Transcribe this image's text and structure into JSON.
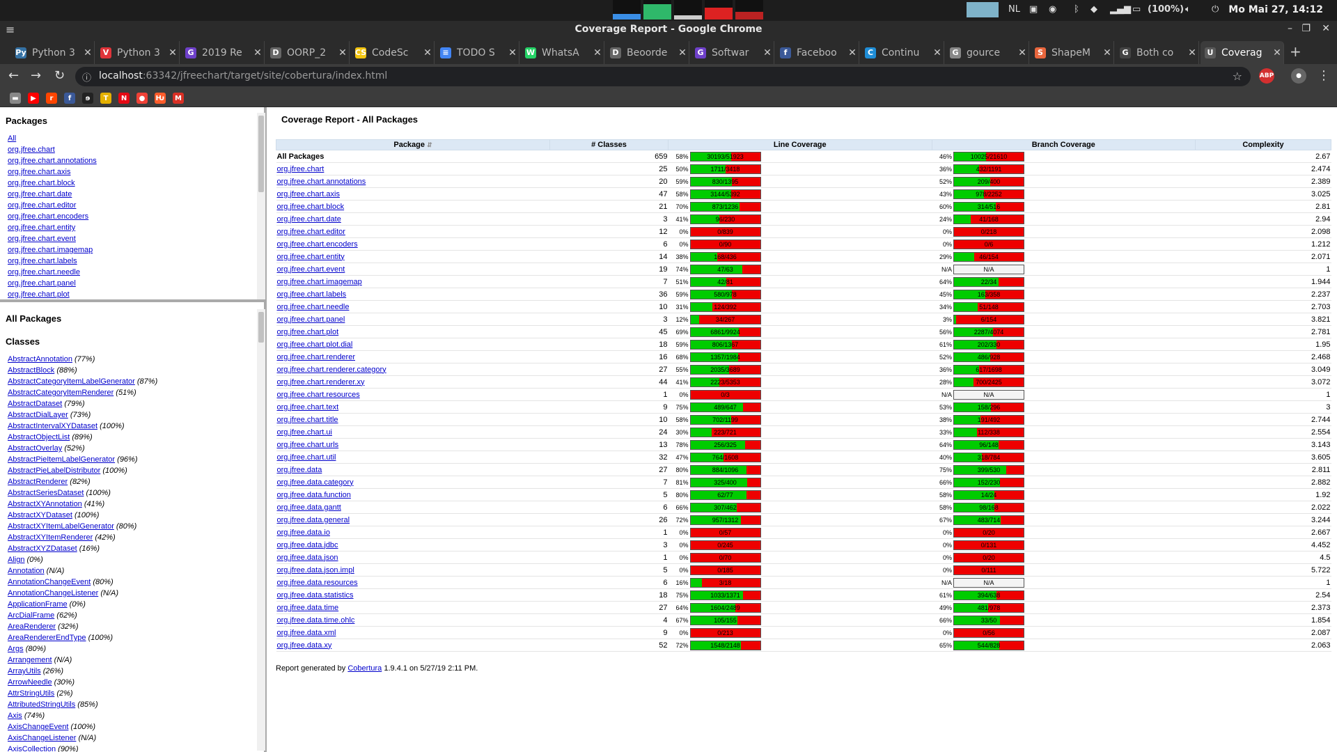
{
  "system": {
    "clock": "Mo Mai 27, 14:12",
    "battery": "(100%)",
    "keyboard": "NL"
  },
  "window": {
    "title": "Coverage Report - Google Chrome"
  },
  "tabs": [
    {
      "label": "Python 3",
      "icon": "python-icon",
      "color": "#3572a5",
      "glyph": "Py"
    },
    {
      "label": "Python 3",
      "icon": "vivaldi-icon",
      "color": "#e0343a",
      "glyph": "V"
    },
    {
      "label": "2019 Re",
      "icon": "github-icon",
      "color": "#6e40c9",
      "glyph": "G"
    },
    {
      "label": "OORP_2",
      "icon": "document-icon",
      "color": "#666",
      "glyph": "D"
    },
    {
      "label": "CodeSc",
      "icon": "codescene-icon",
      "color": "#f2c40f",
      "glyph": "CS"
    },
    {
      "label": "TODO S",
      "icon": "docs-icon",
      "color": "#4285f4",
      "glyph": "≡"
    },
    {
      "label": "WhatsA",
      "icon": "whatsapp-icon",
      "color": "#25d366",
      "glyph": "W"
    },
    {
      "label": "Beoorde",
      "icon": "document-icon",
      "color": "#666",
      "glyph": "D"
    },
    {
      "label": "Softwar",
      "icon": "github-icon",
      "color": "#6e40c9",
      "glyph": "G"
    },
    {
      "label": "Faceboo",
      "icon": "facebook-icon",
      "color": "#3b5998",
      "glyph": "f"
    },
    {
      "label": "Continu",
      "icon": "ci-icon",
      "color": "#1f8dd6",
      "glyph": "C"
    },
    {
      "label": "gource",
      "icon": "google-icon",
      "color": "#888",
      "glyph": "G"
    },
    {
      "label": "ShapeM",
      "icon": "shape-icon",
      "color": "#e8663d",
      "glyph": "S"
    },
    {
      "label": "Both co",
      "icon": "github-icon",
      "color": "#444",
      "glyph": "G"
    },
    {
      "label": "Coverag",
      "icon": "report-icon",
      "color": "#5a5a5a",
      "glyph": "U"
    }
  ],
  "address": {
    "host": "localhost",
    "rest": ":63342/jfreechart/target/site/cobertura/index.html"
  },
  "bookmarks": [
    {
      "icon": "folder-icon",
      "color": "#888",
      "glyph": "▬"
    },
    {
      "icon": "youtube-icon",
      "color": "#ff0000",
      "glyph": "▶"
    },
    {
      "icon": "reddit-icon",
      "color": "#ff4500",
      "glyph": "r"
    },
    {
      "icon": "facebook-icon",
      "color": "#3b5998",
      "glyph": "f"
    },
    {
      "icon": "pocket-icon",
      "color": "#222",
      "glyph": "ɘ"
    },
    {
      "icon": "tweakers-icon",
      "color": "#e5b100",
      "glyph": "T"
    },
    {
      "icon": "netflix-icon",
      "color": "#e50914",
      "glyph": "N"
    },
    {
      "icon": "reader-icon",
      "color": "#ef4136",
      "glyph": "●"
    },
    {
      "icon": "hacker-icon",
      "color": "#ff5c2b",
      "glyph": "Ƕ"
    },
    {
      "icon": "gmail-icon",
      "color": "#d93025",
      "glyph": "M"
    }
  ],
  "packages_frame": {
    "heading": "Packages",
    "items": [
      "All",
      "org.jfree.chart",
      "org.jfree.chart.annotations",
      "org.jfree.chart.axis",
      "org.jfree.chart.block",
      "org.jfree.chart.date",
      "org.jfree.chart.editor",
      "org.jfree.chart.encoders",
      "org.jfree.chart.entity",
      "org.jfree.chart.event",
      "org.jfree.chart.imagemap",
      "org.jfree.chart.labels",
      "org.jfree.chart.needle",
      "org.jfree.chart.panel",
      "org.jfree.chart.plot"
    ]
  },
  "classes_frame": {
    "title": "All Packages",
    "heading": "Classes",
    "items": [
      {
        "name": "AbstractAnnotation",
        "pct": "(77%)"
      },
      {
        "name": "AbstractBlock",
        "pct": "(88%)"
      },
      {
        "name": "AbstractCategoryItemLabelGenerator",
        "pct": "(87%)"
      },
      {
        "name": "AbstractCategoryItemRenderer",
        "pct": "(51%)"
      },
      {
        "name": "AbstractDataset",
        "pct": "(79%)"
      },
      {
        "name": "AbstractDialLayer",
        "pct": "(73%)"
      },
      {
        "name": "AbstractIntervalXYDataset",
        "pct": "(100%)"
      },
      {
        "name": "AbstractObjectList",
        "pct": "(89%)"
      },
      {
        "name": "AbstractOverlay",
        "pct": "(52%)"
      },
      {
        "name": "AbstractPieItemLabelGenerator",
        "pct": "(96%)"
      },
      {
        "name": "AbstractPieLabelDistributor",
        "pct": "(100%)"
      },
      {
        "name": "AbstractRenderer",
        "pct": "(82%)"
      },
      {
        "name": "AbstractSeriesDataset",
        "pct": "(100%)"
      },
      {
        "name": "AbstractXYAnnotation",
        "pct": "(41%)"
      },
      {
        "name": "AbstractXYDataset",
        "pct": "(100%)"
      },
      {
        "name": "AbstractXYItemLabelGenerator",
        "pct": "(80%)"
      },
      {
        "name": "AbstractXYItemRenderer",
        "pct": "(42%)"
      },
      {
        "name": "AbstractXYZDataset",
        "pct": "(16%)"
      },
      {
        "name": "Align",
        "pct": "(0%)"
      },
      {
        "name": "Annotation",
        "pct": "(N/A)"
      },
      {
        "name": "AnnotationChangeEvent",
        "pct": "(80%)"
      },
      {
        "name": "AnnotationChangeListener",
        "pct": "(N/A)"
      },
      {
        "name": "ApplicationFrame",
        "pct": "(0%)"
      },
      {
        "name": "ArcDialFrame",
        "pct": "(62%)"
      },
      {
        "name": "AreaRenderer",
        "pct": "(32%)"
      },
      {
        "name": "AreaRendererEndType",
        "pct": "(100%)"
      },
      {
        "name": "Args",
        "pct": "(80%)"
      },
      {
        "name": "Arrangement",
        "pct": "(N/A)"
      },
      {
        "name": "ArrayUtils",
        "pct": "(26%)"
      },
      {
        "name": "ArrowNeedle",
        "pct": "(30%)"
      },
      {
        "name": "AttrStringUtils",
        "pct": "(2%)"
      },
      {
        "name": "AttributedStringUtils",
        "pct": "(85%)"
      },
      {
        "name": "Axis",
        "pct": "(74%)"
      },
      {
        "name": "AxisChangeEvent",
        "pct": "(100%)"
      },
      {
        "name": "AxisChangeListener",
        "pct": "(N/A)"
      },
      {
        "name": "AxisCollection",
        "pct": "(90%)"
      }
    ]
  },
  "report": {
    "title": "Coverage Report - All Packages",
    "headers": {
      "package": "Package",
      "classes": "# Classes",
      "line": "Line Coverage",
      "branch": "Branch Coverage",
      "complexity": "Complexity"
    },
    "rows": [
      {
        "name": "All Packages",
        "classes": "659",
        "line_pct": "58%",
        "line_ratio": "30193/51923",
        "line_frac": 0.58,
        "branch_pct": "46%",
        "branch_ratio": "10025/21610",
        "branch_frac": 0.46,
        "complexity": "2.67",
        "link": false
      },
      {
        "name": "org.jfree.chart",
        "classes": "25",
        "line_pct": "50%",
        "line_ratio": "1711/3418",
        "line_frac": 0.5,
        "branch_pct": "36%",
        "branch_ratio": "432/1191",
        "branch_frac": 0.36,
        "complexity": "2.474",
        "link": true
      },
      {
        "name": "org.jfree.chart.annotations",
        "classes": "20",
        "line_pct": "59%",
        "line_ratio": "830/1395",
        "line_frac": 0.59,
        "branch_pct": "52%",
        "branch_ratio": "209/400",
        "branch_frac": 0.52,
        "complexity": "2.389",
        "link": true
      },
      {
        "name": "org.jfree.chart.axis",
        "classes": "47",
        "line_pct": "58%",
        "line_ratio": "3144/5392",
        "line_frac": 0.58,
        "branch_pct": "43%",
        "branch_ratio": "978/2252",
        "branch_frac": 0.43,
        "complexity": "3.025",
        "link": true
      },
      {
        "name": "org.jfree.chart.block",
        "classes": "21",
        "line_pct": "70%",
        "line_ratio": "873/1236",
        "line_frac": 0.7,
        "branch_pct": "60%",
        "branch_ratio": "314/516",
        "branch_frac": 0.6,
        "complexity": "2.81",
        "link": true
      },
      {
        "name": "org.jfree.chart.date",
        "classes": "3",
        "line_pct": "41%",
        "line_ratio": "96/230",
        "line_frac": 0.41,
        "branch_pct": "24%",
        "branch_ratio": "41/168",
        "branch_frac": 0.24,
        "complexity": "2.94",
        "link": true
      },
      {
        "name": "org.jfree.chart.editor",
        "classes": "12",
        "line_pct": "0%",
        "line_ratio": "0/839",
        "line_frac": 0,
        "branch_pct": "0%",
        "branch_ratio": "0/218",
        "branch_frac": 0,
        "complexity": "2.098",
        "link": true
      },
      {
        "name": "org.jfree.chart.encoders",
        "classes": "6",
        "line_pct": "0%",
        "line_ratio": "0/90",
        "line_frac": 0,
        "branch_pct": "0%",
        "branch_ratio": "0/6",
        "branch_frac": 0,
        "complexity": "1.212",
        "link": true
      },
      {
        "name": "org.jfree.chart.entity",
        "classes": "14",
        "line_pct": "38%",
        "line_ratio": "168/436",
        "line_frac": 0.38,
        "branch_pct": "29%",
        "branch_ratio": "46/154",
        "branch_frac": 0.29,
        "complexity": "2.071",
        "link": true
      },
      {
        "name": "org.jfree.chart.event",
        "classes": "19",
        "line_pct": "74%",
        "line_ratio": "47/63",
        "line_frac": 0.74,
        "branch_pct": "N/A",
        "branch_ratio": "N/A",
        "branch_frac": null,
        "complexity": "1",
        "link": true
      },
      {
        "name": "org.jfree.chart.imagemap",
        "classes": "7",
        "line_pct": "51%",
        "line_ratio": "42/81",
        "line_frac": 0.51,
        "branch_pct": "64%",
        "branch_ratio": "22/34",
        "branch_frac": 0.64,
        "complexity": "1.944",
        "link": true
      },
      {
        "name": "org.jfree.chart.labels",
        "classes": "36",
        "line_pct": "59%",
        "line_ratio": "580/978",
        "line_frac": 0.59,
        "branch_pct": "45%",
        "branch_ratio": "163/358",
        "branch_frac": 0.45,
        "complexity": "2.237",
        "link": true
      },
      {
        "name": "org.jfree.chart.needle",
        "classes": "10",
        "line_pct": "31%",
        "line_ratio": "124/392",
        "line_frac": 0.31,
        "branch_pct": "34%",
        "branch_ratio": "51/148",
        "branch_frac": 0.34,
        "complexity": "2.703",
        "link": true
      },
      {
        "name": "org.jfree.chart.panel",
        "classes": "3",
        "line_pct": "12%",
        "line_ratio": "34/267",
        "line_frac": 0.12,
        "branch_pct": "3%",
        "branch_ratio": "6/154",
        "branch_frac": 0.03,
        "complexity": "3.821",
        "link": true
      },
      {
        "name": "org.jfree.chart.plot",
        "classes": "45",
        "line_pct": "69%",
        "line_ratio": "6861/9924",
        "line_frac": 0.69,
        "branch_pct": "56%",
        "branch_ratio": "2287/4074",
        "branch_frac": 0.56,
        "complexity": "2.781",
        "link": true
      },
      {
        "name": "org.jfree.chart.plot.dial",
        "classes": "18",
        "line_pct": "59%",
        "line_ratio": "806/1367",
        "line_frac": 0.59,
        "branch_pct": "61%",
        "branch_ratio": "202/330",
        "branch_frac": 0.61,
        "complexity": "1.95",
        "link": true
      },
      {
        "name": "org.jfree.chart.renderer",
        "classes": "16",
        "line_pct": "68%",
        "line_ratio": "1357/1984",
        "line_frac": 0.68,
        "branch_pct": "52%",
        "branch_ratio": "486/928",
        "branch_frac": 0.52,
        "complexity": "2.468",
        "link": true
      },
      {
        "name": "org.jfree.chart.renderer.category",
        "classes": "27",
        "line_pct": "55%",
        "line_ratio": "2035/3689",
        "line_frac": 0.55,
        "branch_pct": "36%",
        "branch_ratio": "617/1698",
        "branch_frac": 0.36,
        "complexity": "3.049",
        "link": true
      },
      {
        "name": "org.jfree.chart.renderer.xy",
        "classes": "44",
        "line_pct": "41%",
        "line_ratio": "2223/5353",
        "line_frac": 0.41,
        "branch_pct": "28%",
        "branch_ratio": "700/2425",
        "branch_frac": 0.28,
        "complexity": "3.072",
        "link": true
      },
      {
        "name": "org.jfree.chart.resources",
        "classes": "1",
        "line_pct": "0%",
        "line_ratio": "0/3",
        "line_frac": 0,
        "branch_pct": "N/A",
        "branch_ratio": "N/A",
        "branch_frac": null,
        "complexity": "1",
        "link": true
      },
      {
        "name": "org.jfree.chart.text",
        "classes": "9",
        "line_pct": "75%",
        "line_ratio": "489/647",
        "line_frac": 0.75,
        "branch_pct": "53%",
        "branch_ratio": "158/296",
        "branch_frac": 0.53,
        "complexity": "3",
        "link": true
      },
      {
        "name": "org.jfree.chart.title",
        "classes": "10",
        "line_pct": "58%",
        "line_ratio": "702/1199",
        "line_frac": 0.58,
        "branch_pct": "38%",
        "branch_ratio": "191/492",
        "branch_frac": 0.38,
        "complexity": "2.744",
        "link": true
      },
      {
        "name": "org.jfree.chart.ui",
        "classes": "24",
        "line_pct": "30%",
        "line_ratio": "223/721",
        "line_frac": 0.3,
        "branch_pct": "33%",
        "branch_ratio": "112/338",
        "branch_frac": 0.33,
        "complexity": "2.554",
        "link": true
      },
      {
        "name": "org.jfree.chart.urls",
        "classes": "13",
        "line_pct": "78%",
        "line_ratio": "256/325",
        "line_frac": 0.78,
        "branch_pct": "64%",
        "branch_ratio": "96/148",
        "branch_frac": 0.64,
        "complexity": "3.143",
        "link": true
      },
      {
        "name": "org.jfree.chart.util",
        "classes": "32",
        "line_pct": "47%",
        "line_ratio": "764/1608",
        "line_frac": 0.47,
        "branch_pct": "40%",
        "branch_ratio": "318/784",
        "branch_frac": 0.4,
        "complexity": "3.605",
        "link": true
      },
      {
        "name": "org.jfree.data",
        "classes": "27",
        "line_pct": "80%",
        "line_ratio": "884/1096",
        "line_frac": 0.8,
        "branch_pct": "75%",
        "branch_ratio": "399/530",
        "branch_frac": 0.75,
        "complexity": "2.811",
        "link": true
      },
      {
        "name": "org.jfree.data.category",
        "classes": "7",
        "line_pct": "81%",
        "line_ratio": "325/400",
        "line_frac": 0.81,
        "branch_pct": "66%",
        "branch_ratio": "152/230",
        "branch_frac": 0.66,
        "complexity": "2.882",
        "link": true
      },
      {
        "name": "org.jfree.data.function",
        "classes": "5",
        "line_pct": "80%",
        "line_ratio": "62/77",
        "line_frac": 0.8,
        "branch_pct": "58%",
        "branch_ratio": "14/24",
        "branch_frac": 0.58,
        "complexity": "1.92",
        "link": true
      },
      {
        "name": "org.jfree.data.gantt",
        "classes": "6",
        "line_pct": "66%",
        "line_ratio": "307/462",
        "line_frac": 0.66,
        "branch_pct": "58%",
        "branch_ratio": "98/168",
        "branch_frac": 0.58,
        "complexity": "2.022",
        "link": true
      },
      {
        "name": "org.jfree.data.general",
        "classes": "26",
        "line_pct": "72%",
        "line_ratio": "957/1312",
        "line_frac": 0.72,
        "branch_pct": "67%",
        "branch_ratio": "483/714",
        "branch_frac": 0.67,
        "complexity": "3.244",
        "link": true
      },
      {
        "name": "org.jfree.data.io",
        "classes": "1",
        "line_pct": "0%",
        "line_ratio": "0/57",
        "line_frac": 0,
        "branch_pct": "0%",
        "branch_ratio": "0/20",
        "branch_frac": 0,
        "complexity": "2.667",
        "link": true
      },
      {
        "name": "org.jfree.data.jdbc",
        "classes": "3",
        "line_pct": "0%",
        "line_ratio": "0/245",
        "line_frac": 0,
        "branch_pct": "0%",
        "branch_ratio": "0/131",
        "branch_frac": 0,
        "complexity": "4.452",
        "link": true
      },
      {
        "name": "org.jfree.data.json",
        "classes": "1",
        "line_pct": "0%",
        "line_ratio": "0/70",
        "line_frac": 0,
        "branch_pct": "0%",
        "branch_ratio": "0/20",
        "branch_frac": 0,
        "complexity": "4.5",
        "link": true
      },
      {
        "name": "org.jfree.data.json.impl",
        "classes": "5",
        "line_pct": "0%",
        "line_ratio": "0/185",
        "line_frac": 0,
        "branch_pct": "0%",
        "branch_ratio": "0/111",
        "branch_frac": 0,
        "complexity": "5.722",
        "link": true
      },
      {
        "name": "org.jfree.data.resources",
        "classes": "6",
        "line_pct": "16%",
        "line_ratio": "3/18",
        "line_frac": 0.16,
        "branch_pct": "N/A",
        "branch_ratio": "N/A",
        "branch_frac": null,
        "complexity": "1",
        "link": true
      },
      {
        "name": "org.jfree.data.statistics",
        "classes": "18",
        "line_pct": "75%",
        "line_ratio": "1033/1371",
        "line_frac": 0.75,
        "branch_pct": "61%",
        "branch_ratio": "394/638",
        "branch_frac": 0.61,
        "complexity": "2.54",
        "link": true
      },
      {
        "name": "org.jfree.data.time",
        "classes": "27",
        "line_pct": "64%",
        "line_ratio": "1604/2489",
        "line_frac": 0.64,
        "branch_pct": "49%",
        "branch_ratio": "481/978",
        "branch_frac": 0.49,
        "complexity": "2.373",
        "link": true
      },
      {
        "name": "org.jfree.data.time.ohlc",
        "classes": "4",
        "line_pct": "67%",
        "line_ratio": "105/155",
        "line_frac": 0.67,
        "branch_pct": "66%",
        "branch_ratio": "33/50",
        "branch_frac": 0.66,
        "complexity": "1.854",
        "link": true
      },
      {
        "name": "org.jfree.data.xml",
        "classes": "9",
        "line_pct": "0%",
        "line_ratio": "0/213",
        "line_frac": 0,
        "branch_pct": "0%",
        "branch_ratio": "0/56",
        "branch_frac": 0,
        "complexity": "2.087",
        "link": true
      },
      {
        "name": "org.jfree.data.xy",
        "classes": "52",
        "line_pct": "72%",
        "line_ratio": "1548/2148",
        "line_frac": 0.72,
        "branch_pct": "65%",
        "branch_ratio": "544/828",
        "branch_frac": 0.65,
        "complexity": "2.063",
        "link": true
      }
    ],
    "footer": {
      "prefix": "Report generated by",
      "link": "Cobertura",
      "suffix": "1.9.4.1 on 5/27/19 2:11 PM."
    }
  }
}
